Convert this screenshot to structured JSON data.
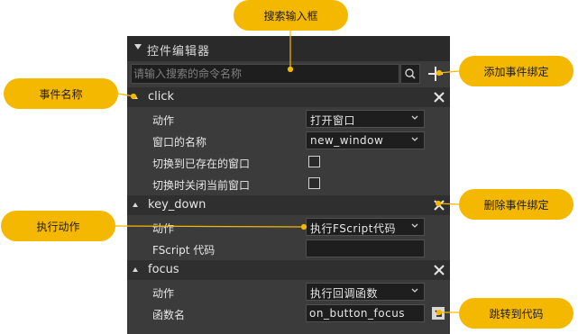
{
  "panel": {
    "title": "控件编辑器",
    "search": {
      "placeholder": "请输入搜索的命令名称"
    }
  },
  "events": [
    {
      "name": "click",
      "rows": [
        {
          "label": "动作",
          "type": "select",
          "value": "打开窗口"
        },
        {
          "label": "窗口的名称",
          "type": "select",
          "value": "new_window"
        },
        {
          "label": "切换到已存在的窗口",
          "type": "checkbox",
          "checked": false
        },
        {
          "label": "切换时关闭当前窗口",
          "type": "checkbox",
          "checked": false
        }
      ]
    },
    {
      "name": "key_down",
      "rows": [
        {
          "label": "动作",
          "type": "select",
          "value": "执行FScript代码"
        },
        {
          "label": "FScript 代码",
          "type": "text",
          "value": ""
        }
      ]
    },
    {
      "name": "focus",
      "rows": [
        {
          "label": "动作",
          "type": "select",
          "value": "执行回调函数"
        },
        {
          "label": "函数名",
          "type": "text",
          "value": "on_button_focus"
        }
      ]
    }
  ],
  "callouts": {
    "search_input": "搜索输入框",
    "add_event_binding": "添加事件绑定",
    "event_name": "事件名称",
    "execute_action": "执行动作",
    "delete_event_binding": "删除事件绑定",
    "jump_to_code": "跳转到代码"
  },
  "colors": {
    "accent": "#f5b800",
    "panel_bg": "#3b3b3b",
    "header_bg": "#2f2f2f",
    "input_bg": "#1e1e1e",
    "text": "#e6e6e6"
  },
  "icons": [
    "search-icon",
    "plus-icon",
    "close-icon",
    "chevron-down-icon",
    "goto-code-icon",
    "collapse-triangle-icon"
  ]
}
